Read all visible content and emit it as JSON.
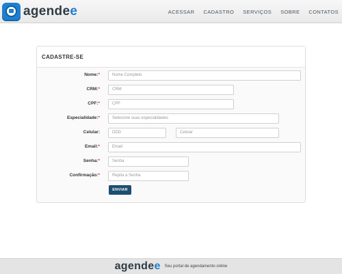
{
  "header": {
    "brand_main": "agende",
    "brand_accent": "e",
    "nav": [
      "ACESSAR",
      "CADASTRO",
      "SERVIÇOS",
      "SOBRE",
      "CONTATOS"
    ]
  },
  "form": {
    "title": "CADASTRE-SE",
    "fields": {
      "nome": {
        "label": "Nome:",
        "required": "*",
        "placeholder": "Nome Completo"
      },
      "crm": {
        "label": "CRM:",
        "required": "*",
        "placeholder": "CRM"
      },
      "cpf": {
        "label": "CPF:",
        "required": "*",
        "placeholder": "CPF"
      },
      "especialidade": {
        "label": "Especialidade:",
        "required": "*",
        "placeholder": "Selecione suas especialidades"
      },
      "celular": {
        "label": "Celular:",
        "ddd_placeholder": "DDD",
        "placeholder": "Celular"
      },
      "email": {
        "label": "Email:",
        "required": "*",
        "placeholder": "Email"
      },
      "senha": {
        "label": "Senha:",
        "required": "*",
        "placeholder": "Senha"
      },
      "confirmacao": {
        "label": "Confirmação:",
        "required": "*",
        "placeholder": "Repita a Senha"
      }
    },
    "submit_label": "ENVIAR"
  },
  "footer": {
    "brand_main": "agende",
    "brand_accent": "e",
    "tagline": "Seu portal de agendamento online"
  },
  "colors": {
    "brand_blue": "#1e7fd0",
    "button": "#1b4f72",
    "required": "#c0392b"
  }
}
